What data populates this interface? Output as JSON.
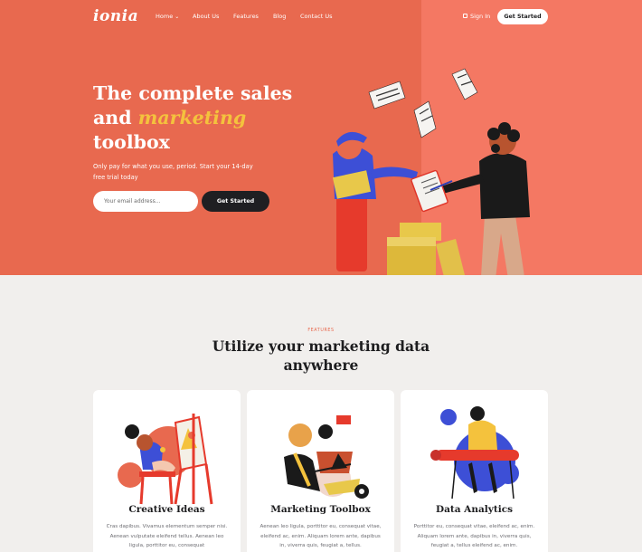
{
  "brand": {
    "logo": "ionia"
  },
  "nav": {
    "items": [
      {
        "label": "Home",
        "has_dropdown": true
      },
      {
        "label": "About Us"
      },
      {
        "label": "Features"
      },
      {
        "label": "Blog"
      },
      {
        "label": "Contact Us"
      }
    ],
    "signin_label": "Sign In",
    "cta_label": "Get Started"
  },
  "hero": {
    "title_line1": "The complete sales",
    "title_line2_pre": "and ",
    "title_line2_accent": "marketing",
    "title_line3": "toolbox",
    "subtitle": "Only pay for what you use, period. Start your 14-day free trial today",
    "email_placeholder": "Your email address...",
    "cta_label": "Get Started"
  },
  "features": {
    "eyebrow": "FEATURES",
    "title": "Utilize your marketing data anywhere",
    "cards": [
      {
        "title": "Creative Ideas",
        "text": "Cras dapibus. Vivamus elementum semper nisi. Aenean vulputate eleifend tellus. Aenean leo ligula, porttitor eu, consequat"
      },
      {
        "title": "Marketing Toolbox",
        "text": "Aenean leo ligula, porttitor eu, consequat vitae, eleifend ac, enim. Aliquam lorem ante, dapibus in, viverra quis, feugiat a, tellus."
      },
      {
        "title": "Data Analytics",
        "text": "Porttitor eu, consequat vitae, eleifend ac, enim. Aliquam lorem ante, dapibus in, viverra quis, feugiat a, tellus eleifend ac, enim."
      }
    ]
  },
  "colors": {
    "hero_bg": "#e8694f",
    "hero_bg_right": "#f47863",
    "accent_yellow": "#f4c23d",
    "dark": "#1f1f22",
    "page_bg": "#f1efed"
  },
  "icons": [
    "chevron-down-icon",
    "lock-icon"
  ]
}
